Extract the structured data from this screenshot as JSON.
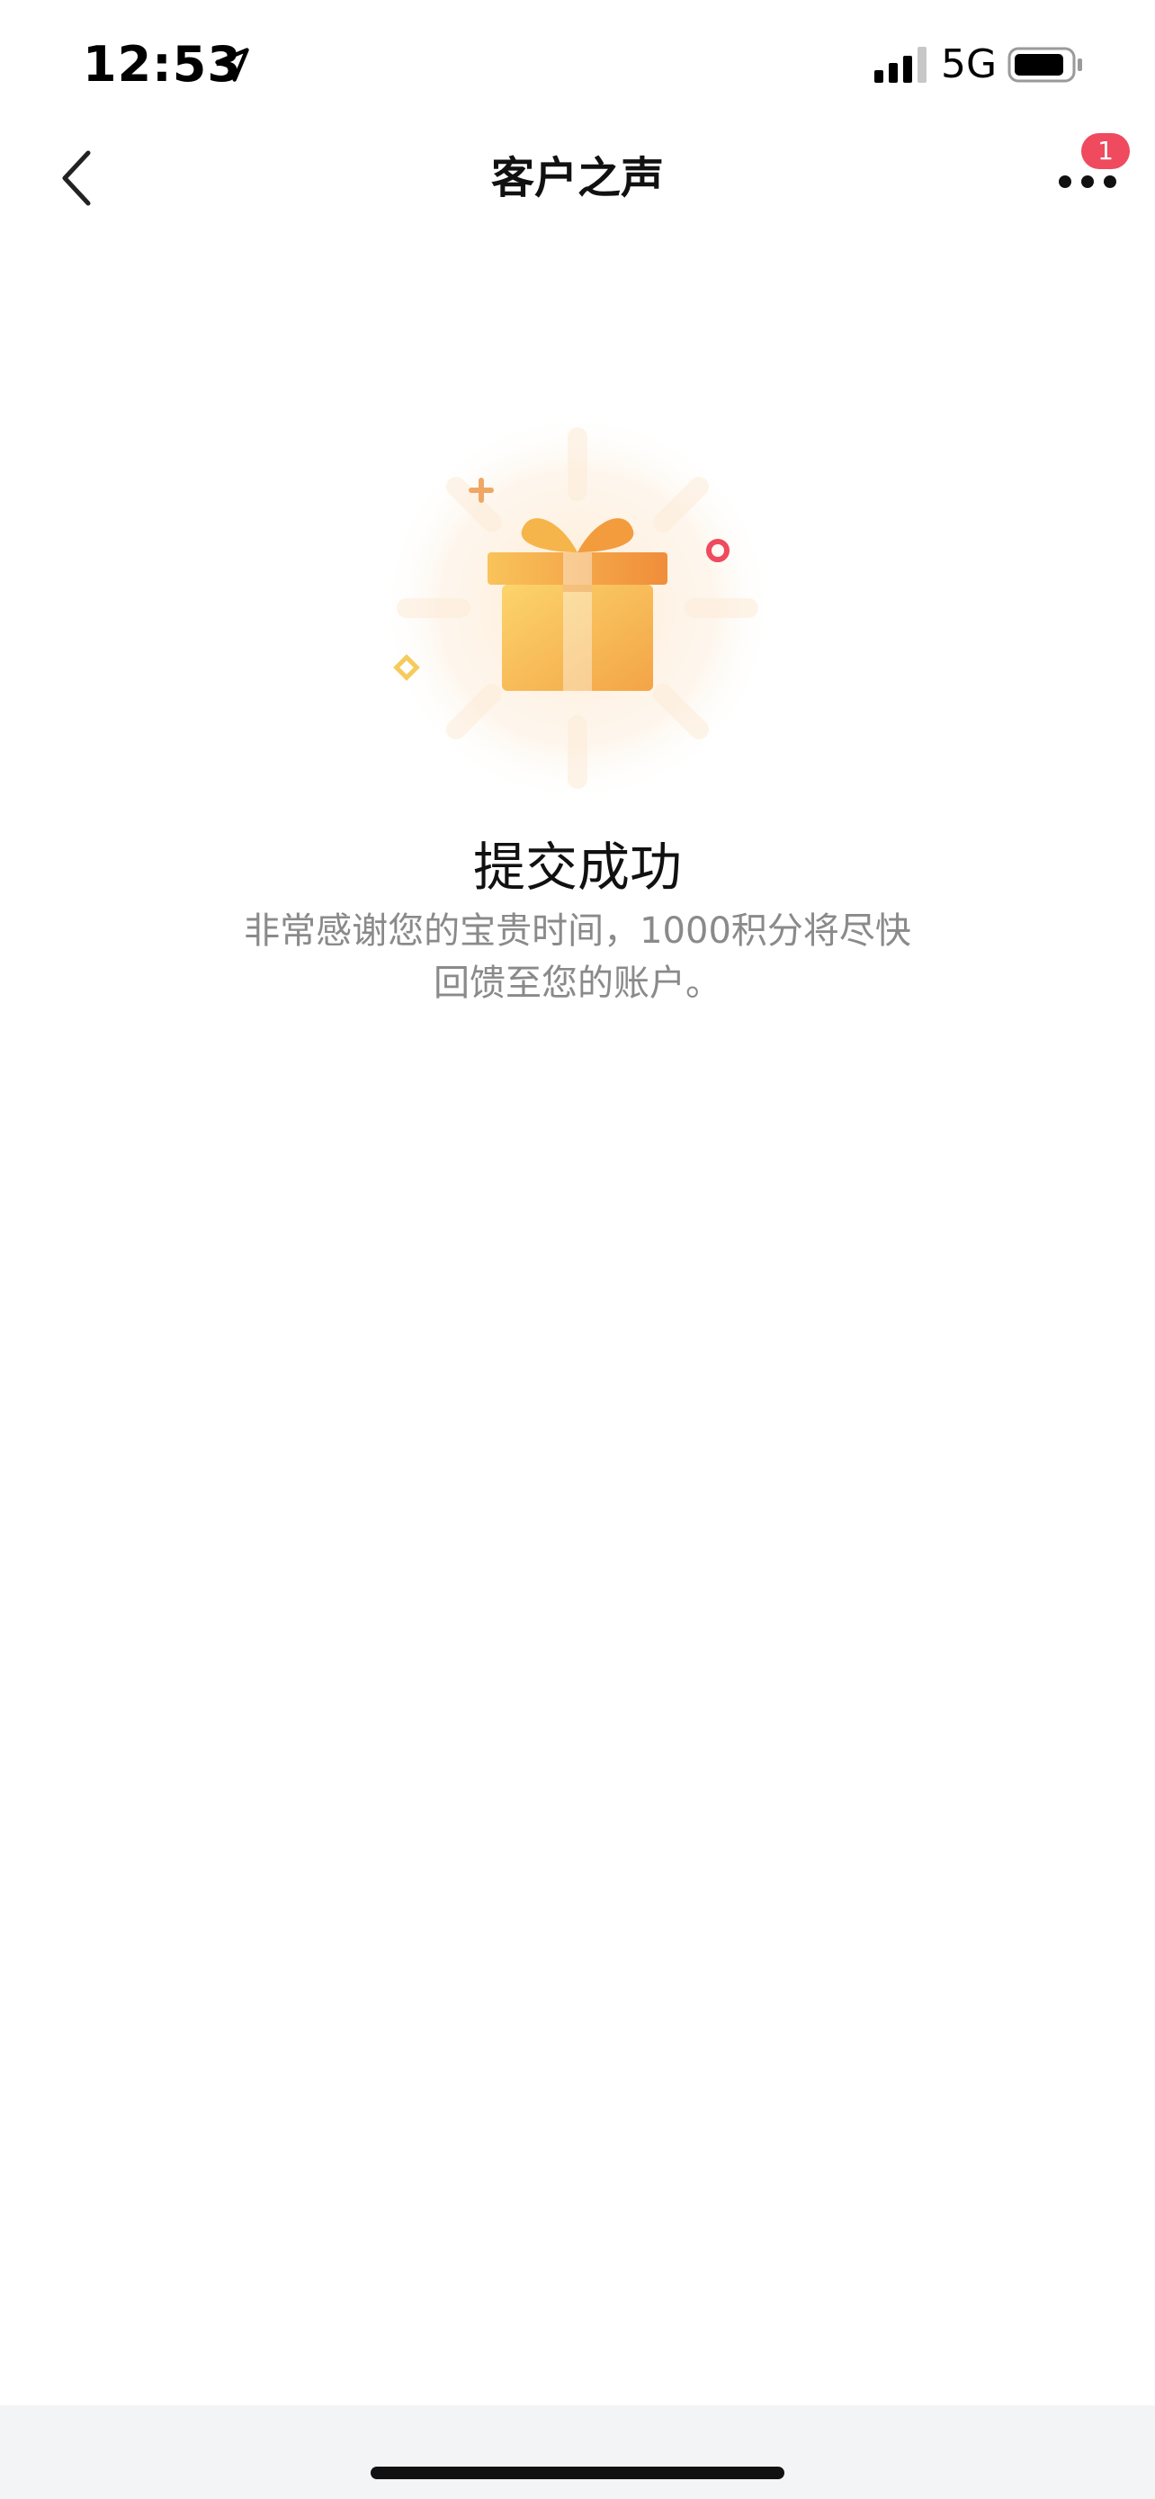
{
  "status_bar": {
    "time": "12:53",
    "network": "5G",
    "icons": [
      "location-arrow-icon",
      "signal-icon",
      "battery-icon"
    ]
  },
  "nav": {
    "title": "客户之声",
    "back_icon": "chevron-left-icon",
    "more_icon": "more-dots-icon",
    "badge_count": "1"
  },
  "success": {
    "icon": "gift-icon",
    "title": "提交成功",
    "message": "非常感谢您的宝贵时间，1000积分将尽快回馈至您的账户。"
  },
  "colors": {
    "badge": "#ef4a5e",
    "gift_light": "#fbd46b",
    "gift_dark": "#f29a3e",
    "message_text": "#8a8a8a",
    "bottom_bar": "#f3f4f6"
  }
}
